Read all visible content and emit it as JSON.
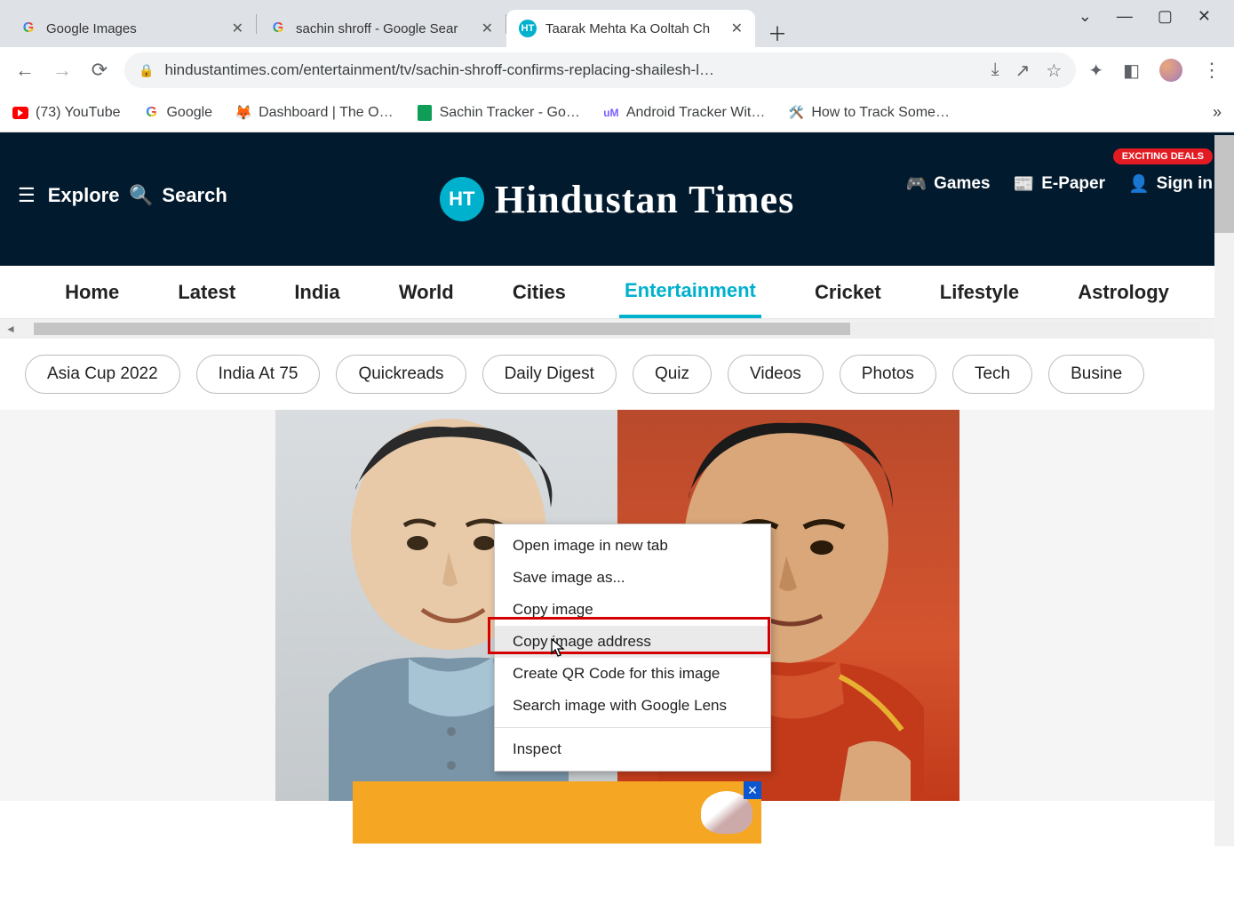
{
  "browser": {
    "tabs": [
      {
        "title": "Google Images",
        "favicon": "g",
        "active": false
      },
      {
        "title": "sachin shroff - Google Sear",
        "favicon": "g",
        "active": false
      },
      {
        "title": "Taarak Mehta Ka Ooltah Ch",
        "favicon": "ht",
        "active": true
      }
    ],
    "url": "hindustantimes.com/entertainment/tv/sachin-shroff-confirms-replacing-shailesh-l…",
    "bookmarks": [
      {
        "icon": "yt",
        "label": "(73) YouTube"
      },
      {
        "icon": "g",
        "label": "Google"
      },
      {
        "icon": "dash",
        "label": "Dashboard | The O…"
      },
      {
        "icon": "sheet",
        "label": "Sachin Tracker - Go…"
      },
      {
        "icon": "um",
        "label": "Android Tracker Wit…"
      },
      {
        "icon": "track",
        "label": "How to Track Some…"
      }
    ]
  },
  "header": {
    "explore": "Explore",
    "search": "Search",
    "site_name": "Hindustan Times",
    "logo_short": "HT",
    "deals_badge": "EXCITING DEALS",
    "links": {
      "games": "Games",
      "epaper": "E-Paper",
      "signin": "Sign in"
    }
  },
  "nav": {
    "items": [
      "Home",
      "Latest",
      "India",
      "World",
      "Cities",
      "Entertainment",
      "Cricket",
      "Lifestyle",
      "Astrology"
    ],
    "active_index": 5
  },
  "chips": [
    "Asia Cup 2022",
    "India At 75",
    "Quickreads",
    "Daily Digest",
    "Quiz",
    "Videos",
    "Photos",
    "Tech",
    "Busine"
  ],
  "context_menu": {
    "items": [
      "Open image in new tab",
      "Save image as...",
      "Copy image",
      "Copy image address",
      "Create QR Code for this image",
      "Search image with Google Lens"
    ],
    "footer_item": "Inspect",
    "hover_index": 3,
    "highlight_index": 3
  }
}
